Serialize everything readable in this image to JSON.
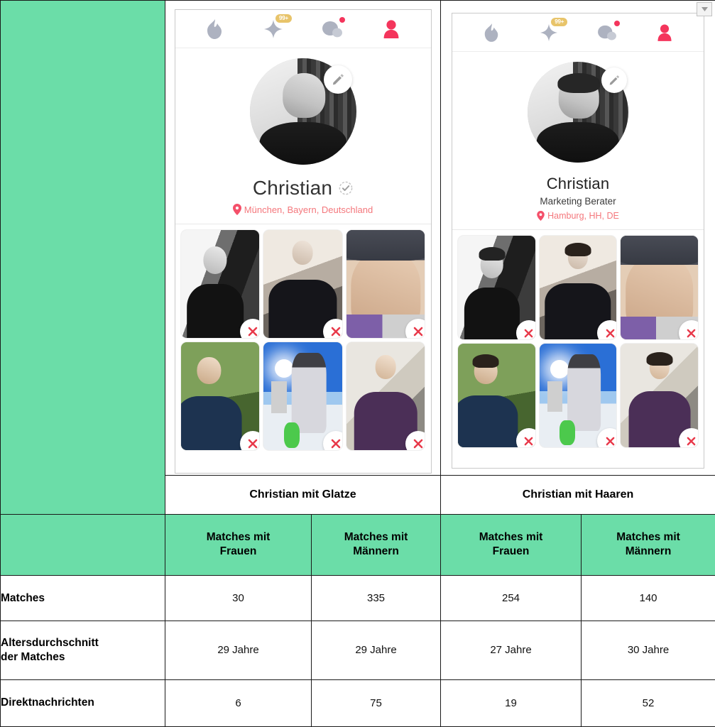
{
  "green_accent": "#6BDDA8",
  "brand_red": "#F4355C",
  "badge_gold": "#E8C46A",
  "profiles": [
    {
      "id": "glatze",
      "caption": "Christian mit Glatze",
      "name": "Christian",
      "job": "",
      "location": "München, Bayern, Deutschland",
      "verified": true,
      "nav": [
        {
          "icon": "flame-icon",
          "badge": "",
          "dot": false
        },
        {
          "icon": "sparkle-icon",
          "badge": "99+",
          "dot": false
        },
        {
          "icon": "chat-bubbles-icon",
          "badge": "",
          "dot": true
        },
        {
          "icon": "person-icon",
          "badge": "",
          "dot": false
        }
      ],
      "edit_icon": "pencil-icon",
      "photos": [
        {
          "alt": "Schwarzweiss Portrait an Hauswand",
          "art": "a1"
        },
        {
          "alt": "Portrait mit verschraenkten Armen",
          "art": "a2"
        },
        {
          "alt": "Nahaufnahme mit Muetze",
          "art": "a3"
        },
        {
          "alt": "Portrait im Gruenen",
          "art": "b1"
        },
        {
          "alt": "Snowboard Foto im Schnee",
          "art": "b2"
        },
        {
          "alt": "Portrait vor Hauswand",
          "art": "b3"
        }
      ],
      "delete_icon": "close-icon"
    },
    {
      "id": "haaren",
      "caption": "Christian mit Haaren",
      "name": "Christian",
      "job": "Marketing Berater",
      "location": "Hamburg, HH, DE",
      "verified": false,
      "nav": [
        {
          "icon": "flame-icon",
          "badge": "",
          "dot": false
        },
        {
          "icon": "sparkle-icon",
          "badge": "99+",
          "dot": false
        },
        {
          "icon": "chat-bubbles-icon",
          "badge": "",
          "dot": true
        },
        {
          "icon": "person-icon",
          "badge": "",
          "dot": false
        }
      ],
      "edit_icon": "pencil-icon",
      "photos": [
        {
          "alt": "Schwarzweiss Portrait an Hauswand",
          "art": "a1"
        },
        {
          "alt": "Portrait mit verschraenkten Armen",
          "art": "a2"
        },
        {
          "alt": "Nahaufnahme mit Muetze",
          "art": "a3"
        },
        {
          "alt": "Portrait im Gruenen",
          "art": "b1"
        },
        {
          "alt": "Snowboard Foto im Schnee",
          "art": "b2"
        },
        {
          "alt": "Portrait vor Hauswand",
          "art": "b3"
        }
      ],
      "delete_icon": "close-icon"
    }
  ],
  "table": {
    "corner_label": "",
    "headers": [
      "Matches mit Frauen",
      "Matches mit Männern",
      "Matches mit Frauen",
      "Matches mit Männern"
    ],
    "headers_split": [
      {
        "l1": "Matches mit",
        "l2": "Frauen"
      },
      {
        "l1": "Matches mit",
        "l2": "Männern"
      },
      {
        "l1": "Matches mit",
        "l2": "Frauen"
      },
      {
        "l1": "Matches mit",
        "l2": "Männern"
      }
    ],
    "rows": [
      {
        "label": "Matches",
        "label_l1": "Matches",
        "label_l2": "",
        "values": [
          "30",
          "335",
          "254",
          "140"
        ]
      },
      {
        "label": "Altersdurchschnitt der Matches",
        "label_l1": "Altersdurchschnitt",
        "label_l2": "der Matches",
        "values": [
          "29 Jahre",
          "29 Jahre",
          "27 Jahre",
          "30 Jahre"
        ]
      },
      {
        "label": "Direktnachrichten",
        "label_l1": "Direktnachrichten",
        "label_l2": "",
        "values": [
          "6",
          "75",
          "19",
          "52"
        ]
      }
    ]
  },
  "window": {
    "spinner_icon": "chevron-down-icon"
  }
}
